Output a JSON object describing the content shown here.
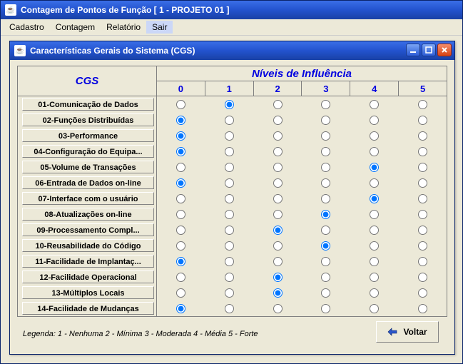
{
  "outer": {
    "title": "Contagem de Pontos de Função [  1 - PROJETO 01  ]"
  },
  "menu": {
    "cadastro": "Cadastro",
    "contagem": "Contagem",
    "relatorio": "Relatório",
    "sair": "Sair"
  },
  "inner": {
    "title": "Características Gerais do Sistema (CGS)"
  },
  "grid": {
    "cgs_header": "CGS",
    "levels_header": "Níveis de Influência",
    "levels": [
      "0",
      "1",
      "2",
      "3",
      "4",
      "5"
    ],
    "rows": [
      {
        "label": "01-Comunicação de Dados",
        "selected": 1
      },
      {
        "label": "02-Funções Distribuídas",
        "selected": 0
      },
      {
        "label": "03-Performance",
        "selected": 0
      },
      {
        "label": "04-Configuração do Equipa...",
        "selected": 0
      },
      {
        "label": "05-Volume de Transações",
        "selected": 4
      },
      {
        "label": "06-Entrada de Dados on-line",
        "selected": 0
      },
      {
        "label": "07-Interface com o usuário",
        "selected": 4
      },
      {
        "label": "08-Atualizações on-line",
        "selected": 3
      },
      {
        "label": "09-Processamento Compl...",
        "selected": 2
      },
      {
        "label": "10-Reusabilidade do Código",
        "selected": 3
      },
      {
        "label": "11-Facilidade de Implantaç...",
        "selected": 0
      },
      {
        "label": "12-Facilidade Operacional",
        "selected": 2
      },
      {
        "label": "13-Múltiplos Locais",
        "selected": 2
      },
      {
        "label": "14-Facilidade de Mudanças",
        "selected": 0
      }
    ]
  },
  "legend": "Legenda:   1 - Nenhuma    2 - Mínima   3 - Moderada   4 - Média   5 - Forte",
  "buttons": {
    "voltar": "Voltar"
  }
}
